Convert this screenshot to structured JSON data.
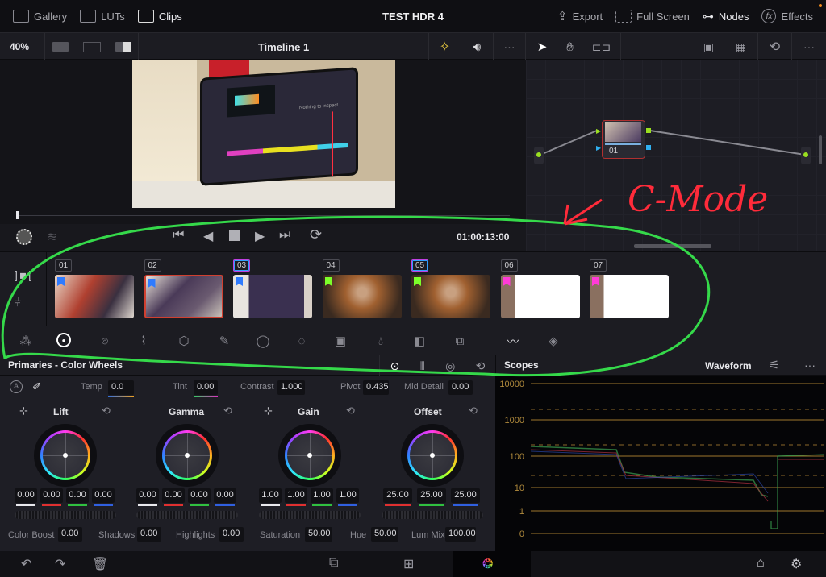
{
  "topbar": {
    "title": "TEST HDR 4",
    "left_items": [
      {
        "label": "Gallery",
        "icon": "gallery-icon"
      },
      {
        "label": "LUTs",
        "icon": "luts-icon"
      },
      {
        "label": "Clips",
        "icon": "clips-icon",
        "active": true
      }
    ],
    "right_items": [
      {
        "label": "Export",
        "icon": "export-icon"
      },
      {
        "label": "Full Screen",
        "icon": "fullscreen-icon"
      },
      {
        "label": "Nodes",
        "icon": "nodes-icon",
        "active": true
      },
      {
        "label": "Effects",
        "icon": "fx-icon"
      }
    ]
  },
  "viewer_toolbar": {
    "zoom": "40%",
    "timeline_name": "Timeline 1"
  },
  "transport": {
    "timecode": "01:00:13:00"
  },
  "node_graph": {
    "nodes": [
      {
        "label": "01"
      }
    ]
  },
  "clips": [
    {
      "num": "01",
      "flag": "#2f7bff",
      "selected": false
    },
    {
      "num": "02",
      "flag": "#2f7bff",
      "selected": true
    },
    {
      "num": "03",
      "flag": "#2f7bff",
      "graded": true
    },
    {
      "num": "04",
      "flag": "#7cff2a"
    },
    {
      "num": "05",
      "flag": "#7cff2a",
      "graded": true
    },
    {
      "num": "06",
      "flag": "#ff3bd8"
    },
    {
      "num": "07",
      "flag": "#ff3bd8"
    }
  ],
  "primaries": {
    "title": "Primaries - Color Wheels",
    "fields": {
      "temp_label": "Temp",
      "temp": "0.0",
      "tint_label": "Tint",
      "tint": "0.00",
      "contrast_label": "Contrast",
      "contrast": "1.000",
      "pivot_label": "Pivot",
      "pivot": "0.435",
      "middetail_label": "Mid Detail",
      "middetail": "0.00"
    },
    "wheels": [
      {
        "name": "Lift",
        "values": [
          "0.00",
          "0.00",
          "0.00",
          "0.00"
        ]
      },
      {
        "name": "Gamma",
        "values": [
          "0.00",
          "0.00",
          "0.00",
          "0.00"
        ]
      },
      {
        "name": "Gain",
        "values": [
          "1.00",
          "1.00",
          "1.00",
          "1.00"
        ]
      },
      {
        "name": "Offset",
        "values": [
          "25.00",
          "25.00",
          "25.00"
        ]
      }
    ],
    "bottom": {
      "colorboost_label": "Color Boost",
      "colorboost": "0.00",
      "shadows_label": "Shadows",
      "shadows": "0.00",
      "highlights_label": "Highlights",
      "highlights": "0.00",
      "saturation_label": "Saturation",
      "saturation": "50.00",
      "hue_label": "Hue",
      "hue": "50.00",
      "lummix_label": "Lum Mix",
      "lummix": "100.00"
    }
  },
  "scopes": {
    "title": "Scopes",
    "mode": "Waveform",
    "scale": [
      "10000",
      "1000",
      "100",
      "10",
      "1",
      "0"
    ]
  },
  "annotation": {
    "text": "C-Mode",
    "text_color": "#ff2b3a",
    "circle_color": "#35d94a"
  }
}
